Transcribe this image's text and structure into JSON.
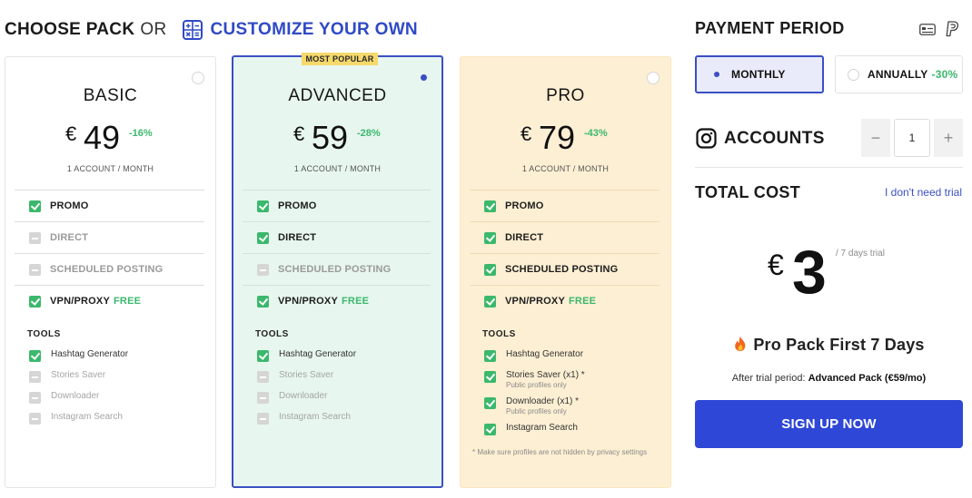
{
  "header": {
    "choose": "CHOOSE PACK",
    "or": "OR",
    "customize": "CUSTOMIZE YOUR OWN"
  },
  "colors": {
    "accent": "#3a4fc3",
    "green": "#3bb86c",
    "button": "#2e47d6",
    "advanced_bg": "#e7f6ef",
    "pro_bg": "#fdefd3"
  },
  "plans": [
    {
      "name": "BASIC",
      "currency": "€",
      "price": "49",
      "discount": "-16%",
      "per": "1 ACCOUNT / MONTH",
      "selected": false,
      "features": [
        {
          "label": "PROMO",
          "enabled": true,
          "free": ""
        },
        {
          "label": "DIRECT",
          "enabled": false,
          "free": ""
        },
        {
          "label": "SCHEDULED POSTING",
          "enabled": false,
          "free": ""
        },
        {
          "label": "VPN/PROXY",
          "enabled": true,
          "free": "FREE"
        }
      ],
      "tools_label": "TOOLS",
      "tools": [
        {
          "label": "Hashtag Generator",
          "enabled": true
        },
        {
          "label": "Stories Saver",
          "enabled": false
        },
        {
          "label": "Downloader",
          "enabled": false
        },
        {
          "label": "Instagram Search",
          "enabled": false
        }
      ]
    },
    {
      "name": "ADVANCED",
      "badge": "MOST POPULAR",
      "currency": "€",
      "price": "59",
      "discount": "-28%",
      "per": "1 ACCOUNT / MONTH",
      "selected": true,
      "features": [
        {
          "label": "PROMO",
          "enabled": true,
          "free": ""
        },
        {
          "label": "DIRECT",
          "enabled": true,
          "free": ""
        },
        {
          "label": "SCHEDULED POSTING",
          "enabled": false,
          "free": ""
        },
        {
          "label": "VPN/PROXY",
          "enabled": true,
          "free": "FREE"
        }
      ],
      "tools_label": "TOOLS",
      "tools": [
        {
          "label": "Hashtag Generator",
          "enabled": true
        },
        {
          "label": "Stories Saver",
          "enabled": false
        },
        {
          "label": "Downloader",
          "enabled": false
        },
        {
          "label": "Instagram Search",
          "enabled": false
        }
      ]
    },
    {
      "name": "PRO",
      "currency": "€",
      "price": "79",
      "discount": "-43%",
      "per": "1 ACCOUNT / MONTH",
      "selected": false,
      "features": [
        {
          "label": "PROMO",
          "enabled": true,
          "free": ""
        },
        {
          "label": "DIRECT",
          "enabled": true,
          "free": ""
        },
        {
          "label": "SCHEDULED POSTING",
          "enabled": true,
          "free": ""
        },
        {
          "label": "VPN/PROXY",
          "enabled": true,
          "free": "FREE"
        }
      ],
      "tools_label": "TOOLS",
      "tools": [
        {
          "label": "Hashtag Generator",
          "enabled": true,
          "sub": ""
        },
        {
          "label": "Stories Saver (x1) *",
          "enabled": true,
          "sub": "Public profiles only"
        },
        {
          "label": "Downloader (x1) *",
          "enabled": true,
          "sub": "Public profiles only"
        },
        {
          "label": "Instagram Search",
          "enabled": true,
          "sub": ""
        }
      ],
      "note": "* Make sure profiles are not hidden by privacy settings"
    }
  ],
  "payment": {
    "title": "PAYMENT PERIOD",
    "monthly": "MONTHLY",
    "annually": "ANNUALLY",
    "annual_discount": "-30%",
    "selected": "monthly"
  },
  "accounts": {
    "label": "ACCOUNTS",
    "minus": "−",
    "plus": "+",
    "value": "1"
  },
  "total": {
    "label": "TOTAL COST",
    "no_trial_link": "I don't need trial",
    "currency": "€",
    "amount": "3",
    "trial": "/ 7 days trial",
    "promo": "Pro Pack First 7 Days",
    "after_prefix": "After trial period: ",
    "after_pack": "Advanced Pack (€59/mo)",
    "cta": "SIGN UP NOW"
  }
}
